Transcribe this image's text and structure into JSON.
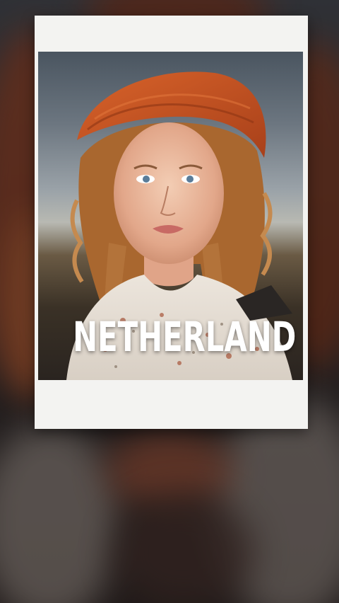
{
  "title": "NETHERLAND",
  "colors": {
    "card": "#f3f3f1",
    "headscarf": "#c4521f",
    "hair": "#b9773d",
    "text": "#ffffff"
  }
}
